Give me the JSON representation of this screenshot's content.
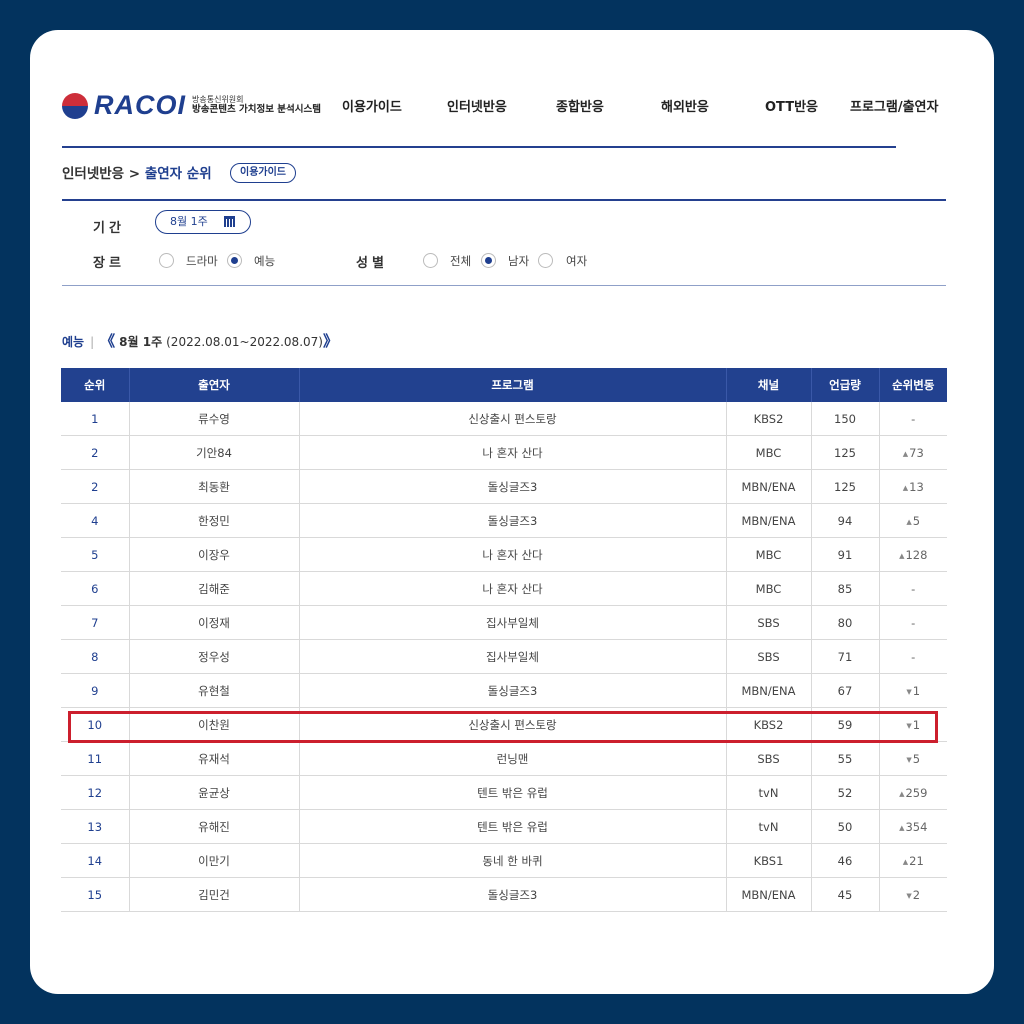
{
  "header": {
    "logo_text": "RACOI",
    "logo_sub_top": "방송통신위원회",
    "logo_sub_bottom": "방송콘텐츠 가치정보 분석시스템",
    "nav": [
      "이용가이드",
      "인터넷반응",
      "종합반응",
      "해외반응",
      "OTT반응",
      "프로그램/출연자"
    ]
  },
  "breadcrumb": {
    "parent": "인터넷반응",
    "separator": " > ",
    "current": "출연자 순위",
    "guide_button": "이용가이드"
  },
  "filters": {
    "period_label": "기간",
    "period_value": "8월 1주",
    "genre_label": "장르",
    "genre_options": [
      {
        "label": "드라마",
        "selected": false
      },
      {
        "label": "예능",
        "selected": true
      }
    ],
    "gender_label": "성별",
    "gender_options": [
      {
        "label": "전체",
        "selected": false
      },
      {
        "label": "남자",
        "selected": true
      },
      {
        "label": "여자",
        "selected": false
      }
    ]
  },
  "summary": {
    "genre": "예능",
    "separator": "|",
    "prev": "《",
    "week": "8월 1주",
    "range": "(2022.08.01~2022.08.07)",
    "next": "》"
  },
  "table": {
    "columns": [
      "순위",
      "출연자",
      "프로그램",
      "채널",
      "언급량",
      "순위변동"
    ],
    "rows": [
      {
        "rank": "1",
        "name": "류수영",
        "program": "신상출시 편스토랑",
        "channel": "KBS2",
        "mentions": "150",
        "dir": "none",
        "change": "-"
      },
      {
        "rank": "2",
        "name": "기안84",
        "program": "나 혼자 산다",
        "channel": "MBC",
        "mentions": "125",
        "dir": "up",
        "change": "73"
      },
      {
        "rank": "2",
        "name": "최동환",
        "program": "돌싱글즈3",
        "channel": "MBN/ENA",
        "mentions": "125",
        "dir": "up",
        "change": "13"
      },
      {
        "rank": "4",
        "name": "한정민",
        "program": "돌싱글즈3",
        "channel": "MBN/ENA",
        "mentions": "94",
        "dir": "up",
        "change": "5"
      },
      {
        "rank": "5",
        "name": "이장우",
        "program": "나 혼자 산다",
        "channel": "MBC",
        "mentions": "91",
        "dir": "up",
        "change": "128"
      },
      {
        "rank": "6",
        "name": "김해준",
        "program": "나 혼자 산다",
        "channel": "MBC",
        "mentions": "85",
        "dir": "none",
        "change": "-"
      },
      {
        "rank": "7",
        "name": "이정재",
        "program": "집사부일체",
        "channel": "SBS",
        "mentions": "80",
        "dir": "none",
        "change": "-"
      },
      {
        "rank": "8",
        "name": "정우성",
        "program": "집사부일체",
        "channel": "SBS",
        "mentions": "71",
        "dir": "none",
        "change": "-"
      },
      {
        "rank": "9",
        "name": "유현철",
        "program": "돌싱글즈3",
        "channel": "MBN/ENA",
        "mentions": "67",
        "dir": "down",
        "change": "1"
      },
      {
        "rank": "10",
        "name": "이찬원",
        "program": "신상출시 편스토랑",
        "channel": "KBS2",
        "mentions": "59",
        "dir": "down",
        "change": "1"
      },
      {
        "rank": "11",
        "name": "유재석",
        "program": "런닝맨",
        "channel": "SBS",
        "mentions": "55",
        "dir": "down",
        "change": "5"
      },
      {
        "rank": "12",
        "name": "윤균상",
        "program": "텐트 밖은 유럽",
        "channel": "tvN",
        "mentions": "52",
        "dir": "up",
        "change": "259"
      },
      {
        "rank": "13",
        "name": "유해진",
        "program": "텐트 밖은 유럽",
        "channel": "tvN",
        "mentions": "50",
        "dir": "up",
        "change": "354"
      },
      {
        "rank": "14",
        "name": "이만기",
        "program": "동네 한 바퀴",
        "channel": "KBS1",
        "mentions": "46",
        "dir": "up",
        "change": "21"
      },
      {
        "rank": "15",
        "name": "김민건",
        "program": "돌싱글즈3",
        "channel": "MBN/ENA",
        "mentions": "45",
        "dir": "down",
        "change": "2"
      }
    ]
  },
  "colors": {
    "frame": "#03335e",
    "accent": "#1f3f8f",
    "highlight": "#cc1f2d"
  }
}
